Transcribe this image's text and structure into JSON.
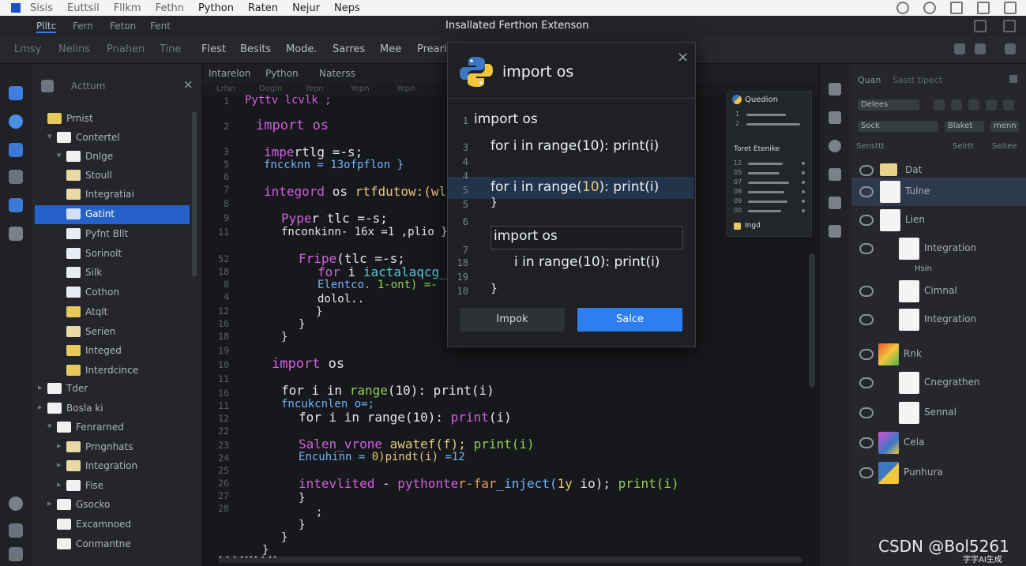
{
  "menubar": {
    "items": [
      "Sisis",
      "Euttsil",
      "Fllkm",
      "Fethn",
      "Python",
      "Raten",
      "Nejur",
      "Neps"
    ]
  },
  "window": {
    "title": "Insallated Ferthon Extenson"
  },
  "tabbar": {
    "tabs": [
      "Plltc",
      "Fern",
      "Feton",
      "Fent"
    ]
  },
  "toolbar": {
    "items": [
      "Lmsy",
      "Nelins",
      "Pnahen",
      "Tine",
      "Flest",
      "Besits",
      "Mode.",
      "Sarres",
      "Mee",
      "Preari"
    ]
  },
  "explorer": {
    "search_label": "Acttum",
    "tree": [
      {
        "label": "Prnist",
        "icon": "folder-icon"
      },
      {
        "label": "Contertel",
        "icon": "folder-icon"
      },
      {
        "label": "Dnlge",
        "icon": "folder-icon"
      },
      {
        "label": "Stoull",
        "icon": "folder-icon"
      },
      {
        "label": "Integratiai",
        "icon": "folder-icon"
      },
      {
        "label": "Gatint",
        "icon": "file-icon",
        "selected": true
      },
      {
        "label": "Pyfnt Bllt",
        "icon": "file-icon"
      },
      {
        "label": "Sorinolt",
        "icon": "file-icon"
      },
      {
        "label": "Silk",
        "icon": "file-icon"
      },
      {
        "label": "Cothon",
        "icon": "file-icon"
      },
      {
        "label": "Atqlt",
        "icon": "folder-icon"
      },
      {
        "label": "Serien",
        "icon": "folder-icon"
      },
      {
        "label": "Integed",
        "icon": "folder-icon"
      },
      {
        "label": "Interdcince",
        "icon": "folder-icon"
      },
      {
        "label": "Tder",
        "icon": "folder-icon"
      },
      {
        "label": "Bosla ki",
        "icon": "folder-icon"
      },
      {
        "label": "Fenrarned",
        "icon": "folder-icon"
      },
      {
        "label": "Prngnhats",
        "icon": "folder-icon"
      },
      {
        "label": "Integration",
        "icon": "folder-icon"
      },
      {
        "label": "Fise",
        "icon": "folder-icon"
      },
      {
        "label": "Gsocko",
        "icon": "folder-icon"
      },
      {
        "label": "Excamnoed",
        "icon": "folder-icon"
      },
      {
        "label": "Conmantne",
        "icon": "folder-icon"
      }
    ]
  },
  "editor": {
    "tabs": [
      "Intarelon",
      "Python",
      "Naterss"
    ],
    "subtabs": [
      "Lrlsn",
      "Dogin",
      "Yepn",
      "Yepn",
      "Yepn"
    ],
    "line_numbers": [
      "1",
      "2",
      "3",
      "5",
      "6",
      "7",
      "8",
      "9",
      "11",
      "52",
      "18",
      "8",
      "4",
      "12",
      "16",
      "18",
      "19",
      "10",
      "11",
      "16",
      "11",
      "12",
      "22",
      "23",
      "24",
      "25",
      "26",
      "27",
      "28"
    ],
    "code": {
      "l0": "Pyttv lcvlk ;",
      "l1": "import os",
      "l2a": "impe",
      "l2b": "rtlg =-s;",
      "l3": "fnccknn = 13ofpflon }",
      "l4a": "integord",
      "l4b": " os ",
      "l4c": "rtfdutow:(wlond",
      "l5a": "Pype",
      "l5b": "r tlc =-s;",
      "l6": "fnconkinn- 16x =1 ,plio }",
      "l7a": "Fripe",
      "l7b": "(tlc =-s;",
      "l8a": "for",
      "l8b": " i ",
      "l8c": "iactalaqcg_l",
      "l9a": "Elentco.",
      "l9b": " 1-ont) =-",
      "l10": "dolol..",
      "l11": "}",
      "l12": "}",
      "l13": "}",
      "l14a": "import",
      "l14b": " os",
      "l15a": "for i in ",
      "l15b": "range",
      "l15c": "(10): print(i)",
      "l16": "fncukcnlen o=;",
      "l17a": "for i in range(10): ",
      "l17b": "print",
      "l17c": "(i)",
      "l18a": "Salen_vrone",
      "l18b": " awatef(f); ",
      "l18c": "print(i)",
      "l19a": "Encuhinn = ",
      "l19b": "0)pindt(i)",
      "l19c": " =12",
      "l20a": "intevlited",
      "l20b": " - ",
      "l20c": "pythonte",
      "l20d": "r-far",
      "l20e": "_inject(",
      "l20f": "1y",
      "l20g": " io); ",
      "l20h": "print(i)",
      "l21": "}",
      "l22": ";",
      "l23": "}",
      "l24": "}",
      "l25": "}"
    },
    "status": "• • • •••• • ••"
  },
  "dialog": {
    "title": "import os",
    "line_numbers": [
      "1",
      "3",
      "4",
      "4",
      "5",
      "5",
      "6",
      "7",
      "18",
      "19",
      "10"
    ],
    "lines": {
      "d1": "import os",
      "d3": "for i in range(10): print(i)",
      "d5a": "for i in range(",
      "d5b": "10",
      "d5c": "): print(i)",
      "d5close": "}",
      "input": "import os",
      "d18": "i in range(10): print(i)",
      "d10": "}"
    },
    "cancel_label": "Impok",
    "confirm_label": "Salce"
  },
  "question_panel": {
    "title": "Quedion",
    "nums_top": [
      "1",
      "2"
    ],
    "subtitle": "Toret Etenike",
    "nums": [
      "12",
      "05",
      "07",
      "08",
      "09",
      "00"
    ],
    "footer": "Ingd"
  },
  "layers": {
    "tabs": [
      "Quan",
      "Sastt tlpect"
    ],
    "dropdown1": "Delees",
    "dropdown2": "Sock",
    "dropdown3": "Blaket",
    "dropdown4": "menn",
    "filter_label": "Sensttt",
    "filter_value": "Selrtt",
    "filter_extra": "Seitee",
    "rows": [
      {
        "name": "Dat",
        "thumb": "folder"
      },
      {
        "name": "Tulne",
        "thumb": "white",
        "selected": true
      },
      {
        "name": "Lien",
        "thumb": "white"
      },
      {
        "name": "Integration",
        "thumb": "white"
      },
      {
        "name": "Hsin",
        "thumb": "none"
      },
      {
        "name": "Cimnal",
        "thumb": "white"
      },
      {
        "name": "Integration",
        "thumb": "white"
      },
      {
        "name": "Rnk",
        "thumb": "color"
      },
      {
        "name": "Cnegrathen",
        "thumb": "white"
      },
      {
        "name": "Sennal",
        "thumb": "white"
      },
      {
        "name": "Cela",
        "thumb": "color2"
      },
      {
        "name": "Punhura",
        "thumb": "python"
      }
    ]
  },
  "watermark": {
    "text": "CSDN @Bol5261",
    "sub": "字字AI生成"
  },
  "colors": {
    "accent": "#2d7ff0",
    "selection": "#2561c9",
    "keyword": "#d060e0",
    "function": "#8fd14f",
    "number": "#e8c878"
  }
}
